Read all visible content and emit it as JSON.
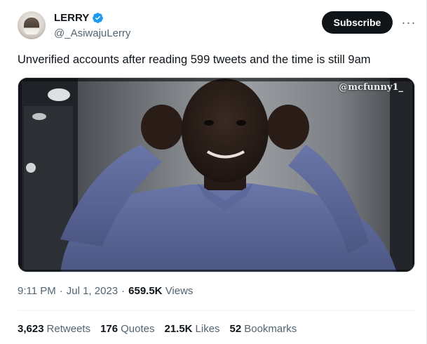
{
  "author": {
    "display_name": "LERRY",
    "handle": "@_AsiwajuLerry",
    "verified_badge_icon": "verified-badge-icon",
    "badge_color": "#1d9bf0"
  },
  "header": {
    "subscribe_label": "Subscribe",
    "more_icon": "more-dots-icon",
    "more_glyph": "···"
  },
  "tweet": {
    "text": "Unverified accounts after reading 599 tweets and the time is still 9am"
  },
  "media": {
    "watermark": "@mcfunny1_"
  },
  "meta": {
    "time": "9:11 PM",
    "sep1": "·",
    "date": "Jul 1, 2023",
    "sep2": "·",
    "views_count": "659.5K",
    "views_label": "Views"
  },
  "stats": {
    "retweets_count": "3,623",
    "retweets_label": "Retweets",
    "quotes_count": "176",
    "quotes_label": "Quotes",
    "likes_count": "21.5K",
    "likes_label": "Likes",
    "bookmarks_count": "52",
    "bookmarks_label": "Bookmarks"
  }
}
